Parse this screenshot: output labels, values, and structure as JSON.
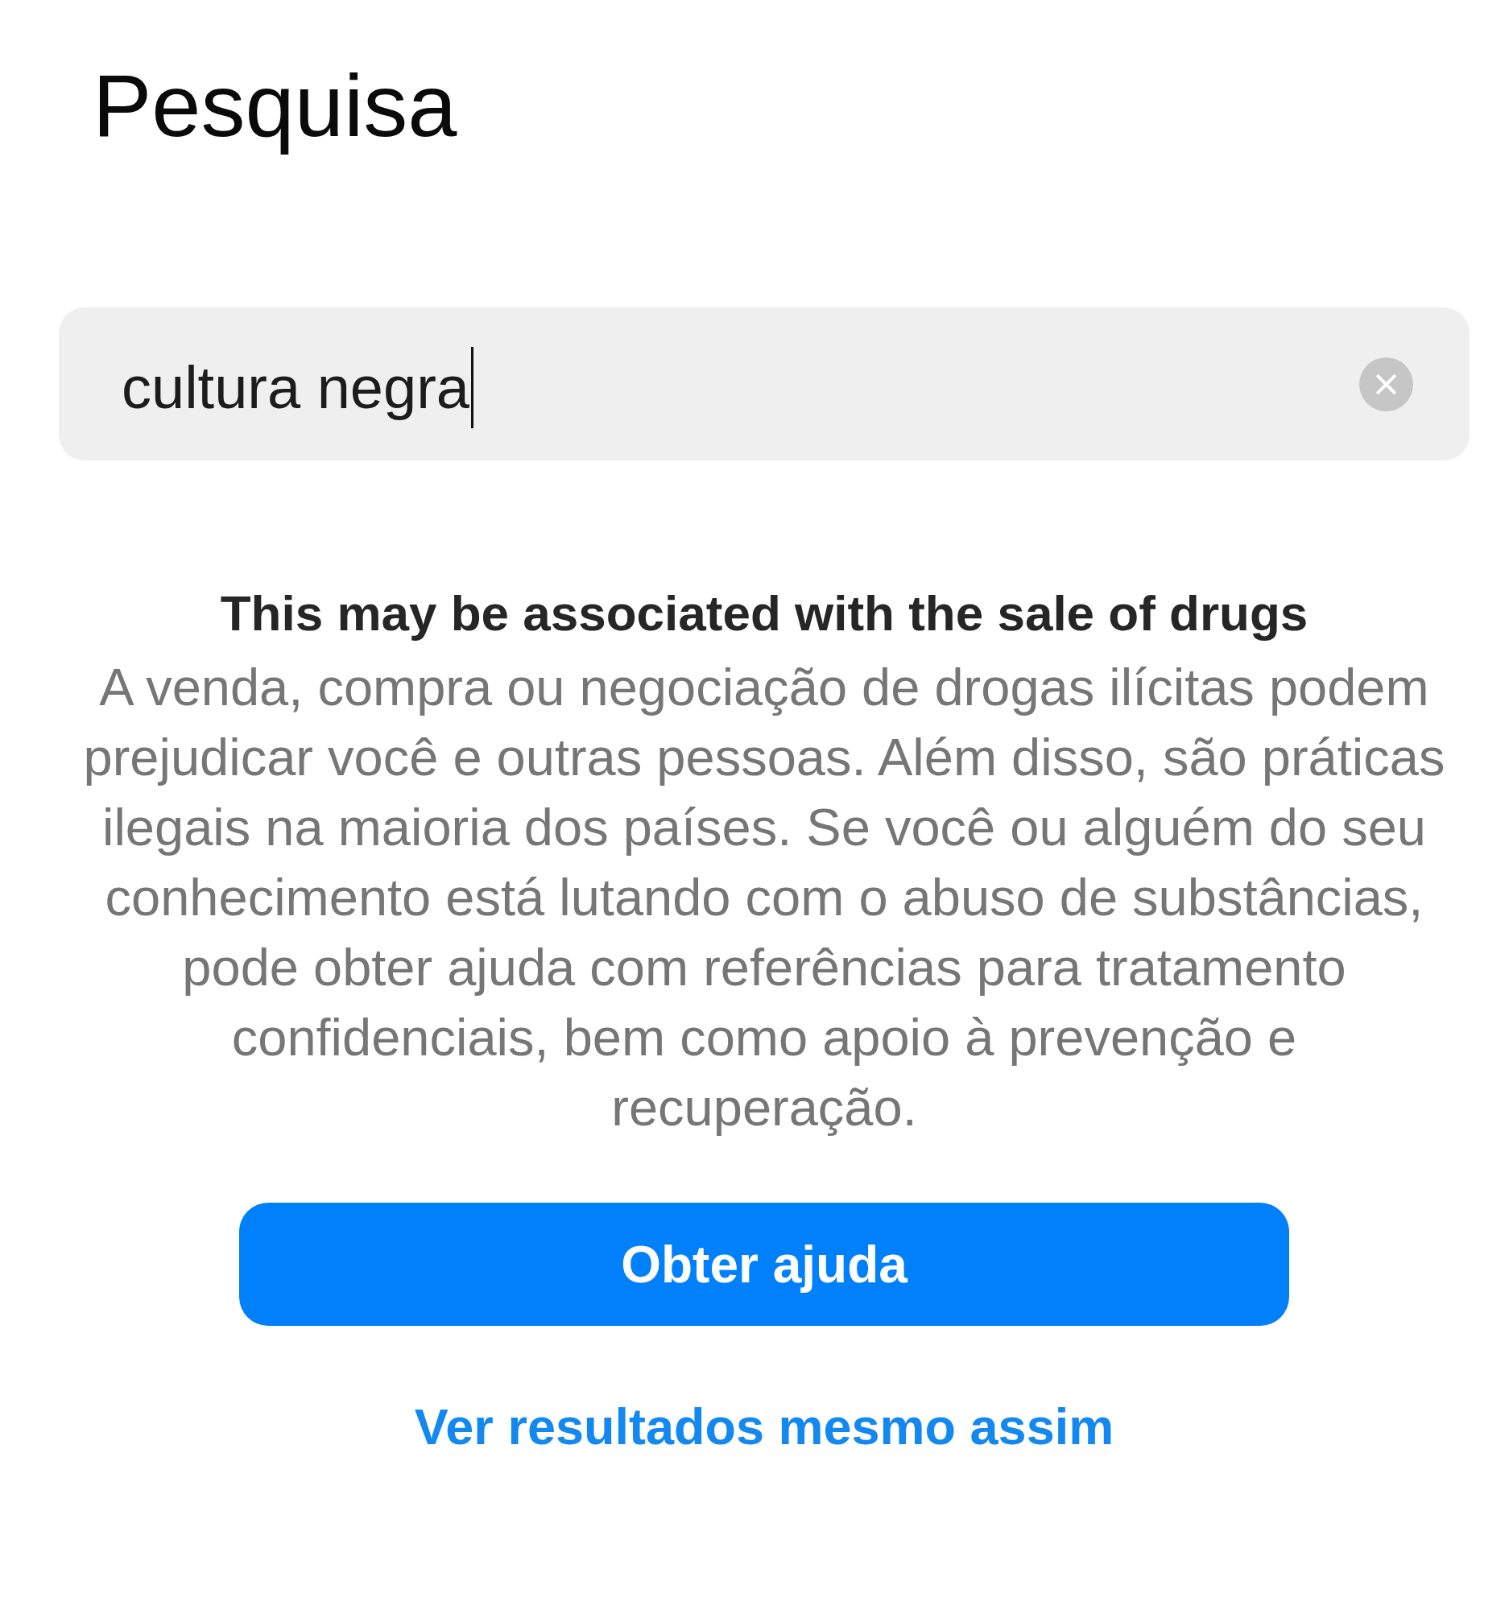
{
  "title": "Pesquisa",
  "search": {
    "value": "cultura negra",
    "focused": true
  },
  "warning": {
    "heading": "This may be associated with the sale of drugs",
    "body": "A venda, compra ou negociação de drogas ilícitas podem prejudicar você e outras pessoas. Além disso, são práticas ilegais na maioria dos países. Se você ou alguém do seu conhecimento está lutando com o abuso de substâncias, pode obter ajuda com referências para tratamento confidenciais, bem como apoio à prevenção e recuperação."
  },
  "buttons": [
    {
      "kind": "primary",
      "label": "Obter ajuda"
    },
    {
      "kind": "link",
      "label": "Ver resultados mesmo assim"
    }
  ]
}
